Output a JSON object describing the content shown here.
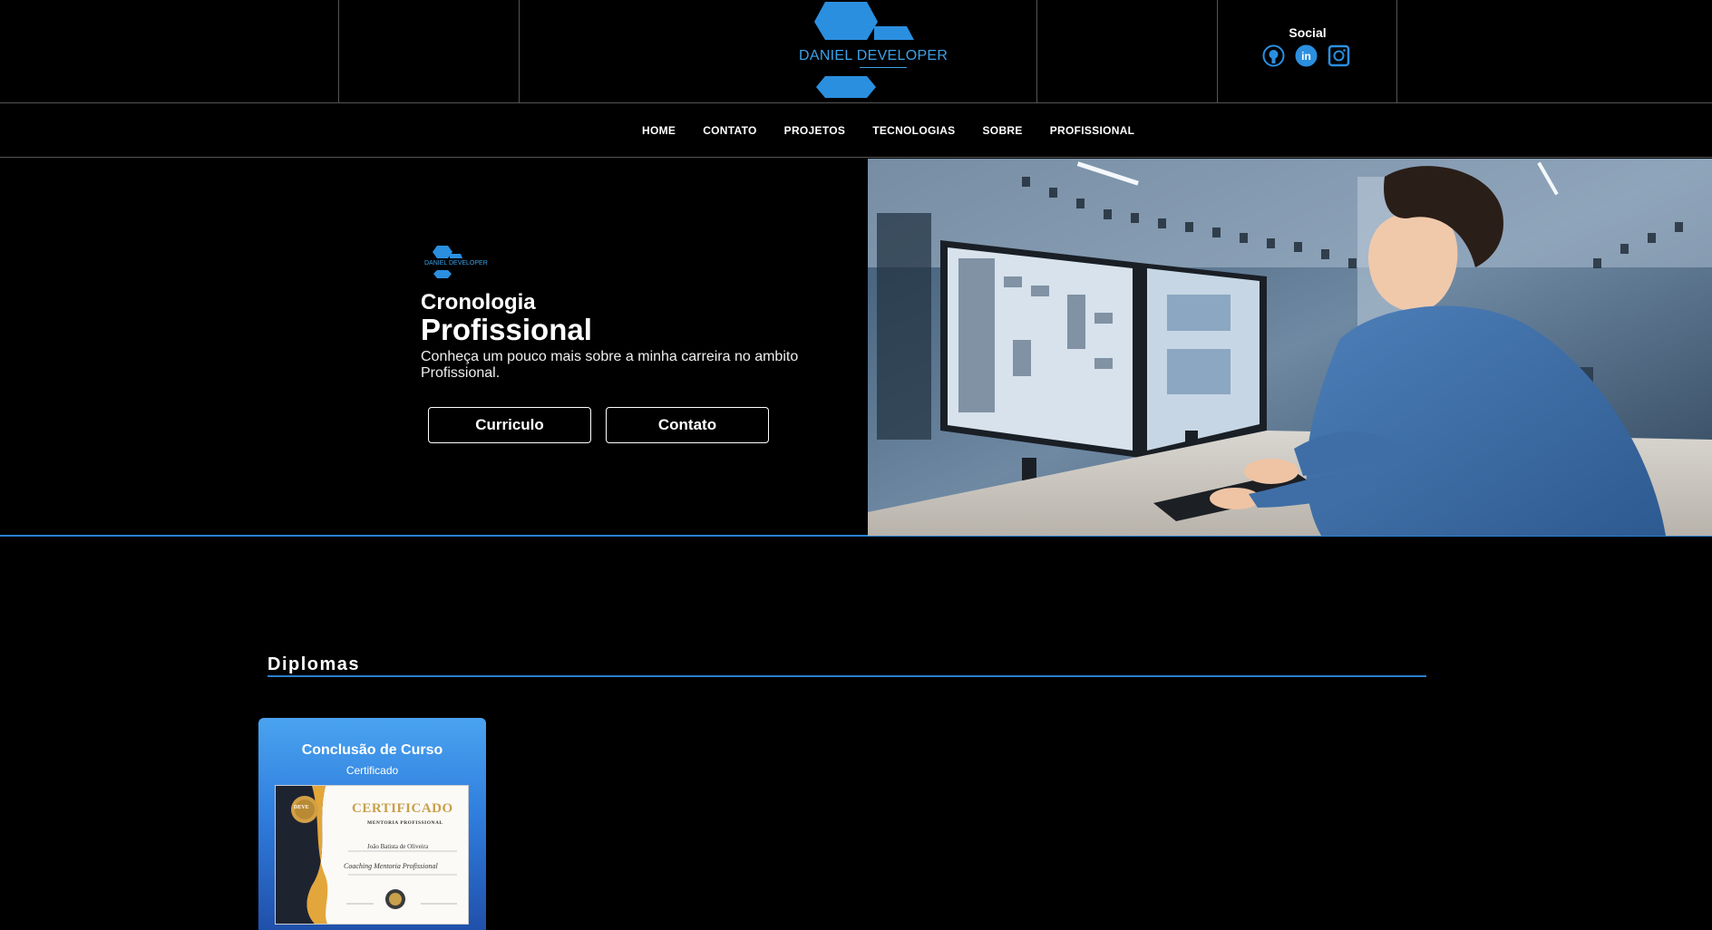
{
  "header": {
    "logo_text": "DANIEL DEVELOPER",
    "social_title": "Social",
    "social_icons": [
      "github-icon",
      "linkedin-icon",
      "instagram-icon"
    ]
  },
  "nav": {
    "items": [
      "HOME",
      "CONTATO",
      "PROJETOS",
      "TECNOLOGIAS",
      "SOBRE",
      "PROFISSIONAL"
    ]
  },
  "hero": {
    "logo_text": "DANIEL DEVELOPER",
    "subtitle": "Cronologia",
    "title": "Profissional",
    "description": "Conheça um pouco mais sobre a minha carreira no ambito Profissional.",
    "buttons": {
      "curriculo": "Curriculo",
      "contato": "Contato"
    }
  },
  "diplomas": {
    "section_title": "Diplomas",
    "cards": [
      {
        "title": "Conclusão de Curso",
        "subtitle": "Certificado",
        "certificate": {
          "heading": "CERTIFICADO",
          "subheading": "MENTORIA PROFISSIONAL",
          "name": "João Batista de Oliveira",
          "course": "Coaching Mentoria Profissional",
          "seal": "DEVE"
        }
      }
    ]
  },
  "colors": {
    "accent": "#2b7fd1",
    "logo_blue": "#3da2e8",
    "background": "#000000"
  }
}
